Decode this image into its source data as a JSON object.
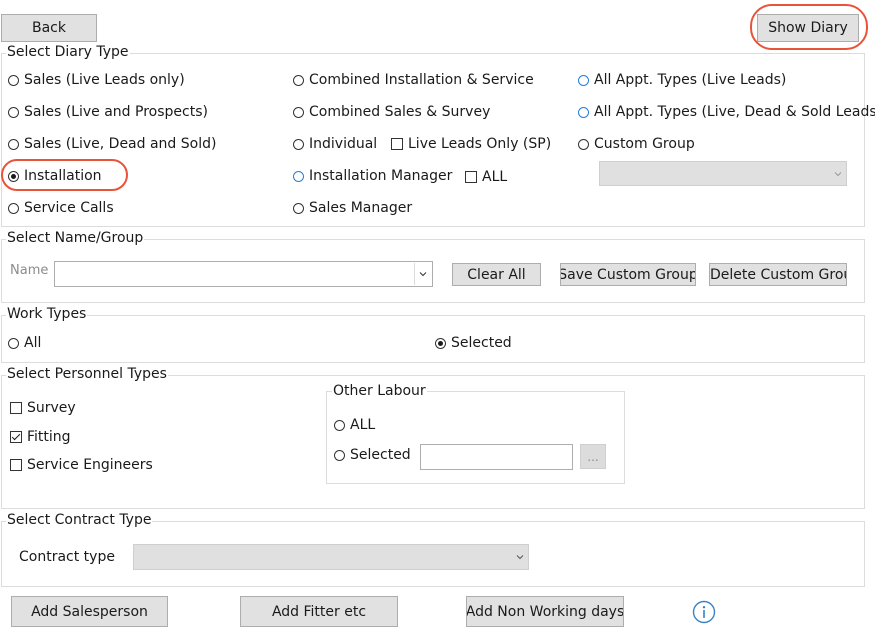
{
  "buttons": {
    "back": "Back",
    "show_diary": "Show Diary",
    "clear_all": "Clear All",
    "save_custom_group": "Save Custom Group",
    "delete_custom_group": "Delete Custom Group",
    "ellipsis": "...",
    "add_salesperson": "Add Salesperson",
    "add_fitter": "Add Fitter etc",
    "add_non_working": "Add Non Working days"
  },
  "diary_type": {
    "title": "Select Diary Type",
    "col1": [
      "Sales (Live Leads only)",
      "Sales (Live and Prospects)",
      "Sales (Live, Dead and Sold)",
      "Installation",
      "Service Calls"
    ],
    "col2": [
      "Combined Installation & Service",
      "Combined Sales & Survey",
      "Individual",
      "Installation Manager",
      "Sales Manager"
    ],
    "col3": [
      "All Appt. Types (Live Leads)",
      "All Appt. Types (Live, Dead & Sold Leads)",
      "Custom Group"
    ],
    "live_leads_only": "Live Leads Only (SP)",
    "all_check": "ALL",
    "selected": "Installation"
  },
  "name_group": {
    "title": "Select Name/Group",
    "name_label": "Name",
    "name_value": ""
  },
  "work_types": {
    "title": "Work Types",
    "all": "All",
    "selected": "Selected",
    "current": "Selected"
  },
  "personnel": {
    "title": "Select Personnel Types",
    "items": [
      {
        "label": "Survey",
        "checked": false
      },
      {
        "label": "Fitting",
        "checked": true
      },
      {
        "label": "Service Engineers",
        "checked": false
      }
    ],
    "other_labour": {
      "title": "Other Labour",
      "all": "ALL",
      "selected": "Selected",
      "value": ""
    }
  },
  "contract": {
    "title": "Select Contract Type",
    "label": "Contract type",
    "value": ""
  },
  "colors": {
    "highlight": "#e8543a",
    "radio_blue": "#2a7fd4",
    "info_blue": "#3b82c4"
  },
  "icons": [
    "chevron-down-icon",
    "info-icon"
  ]
}
